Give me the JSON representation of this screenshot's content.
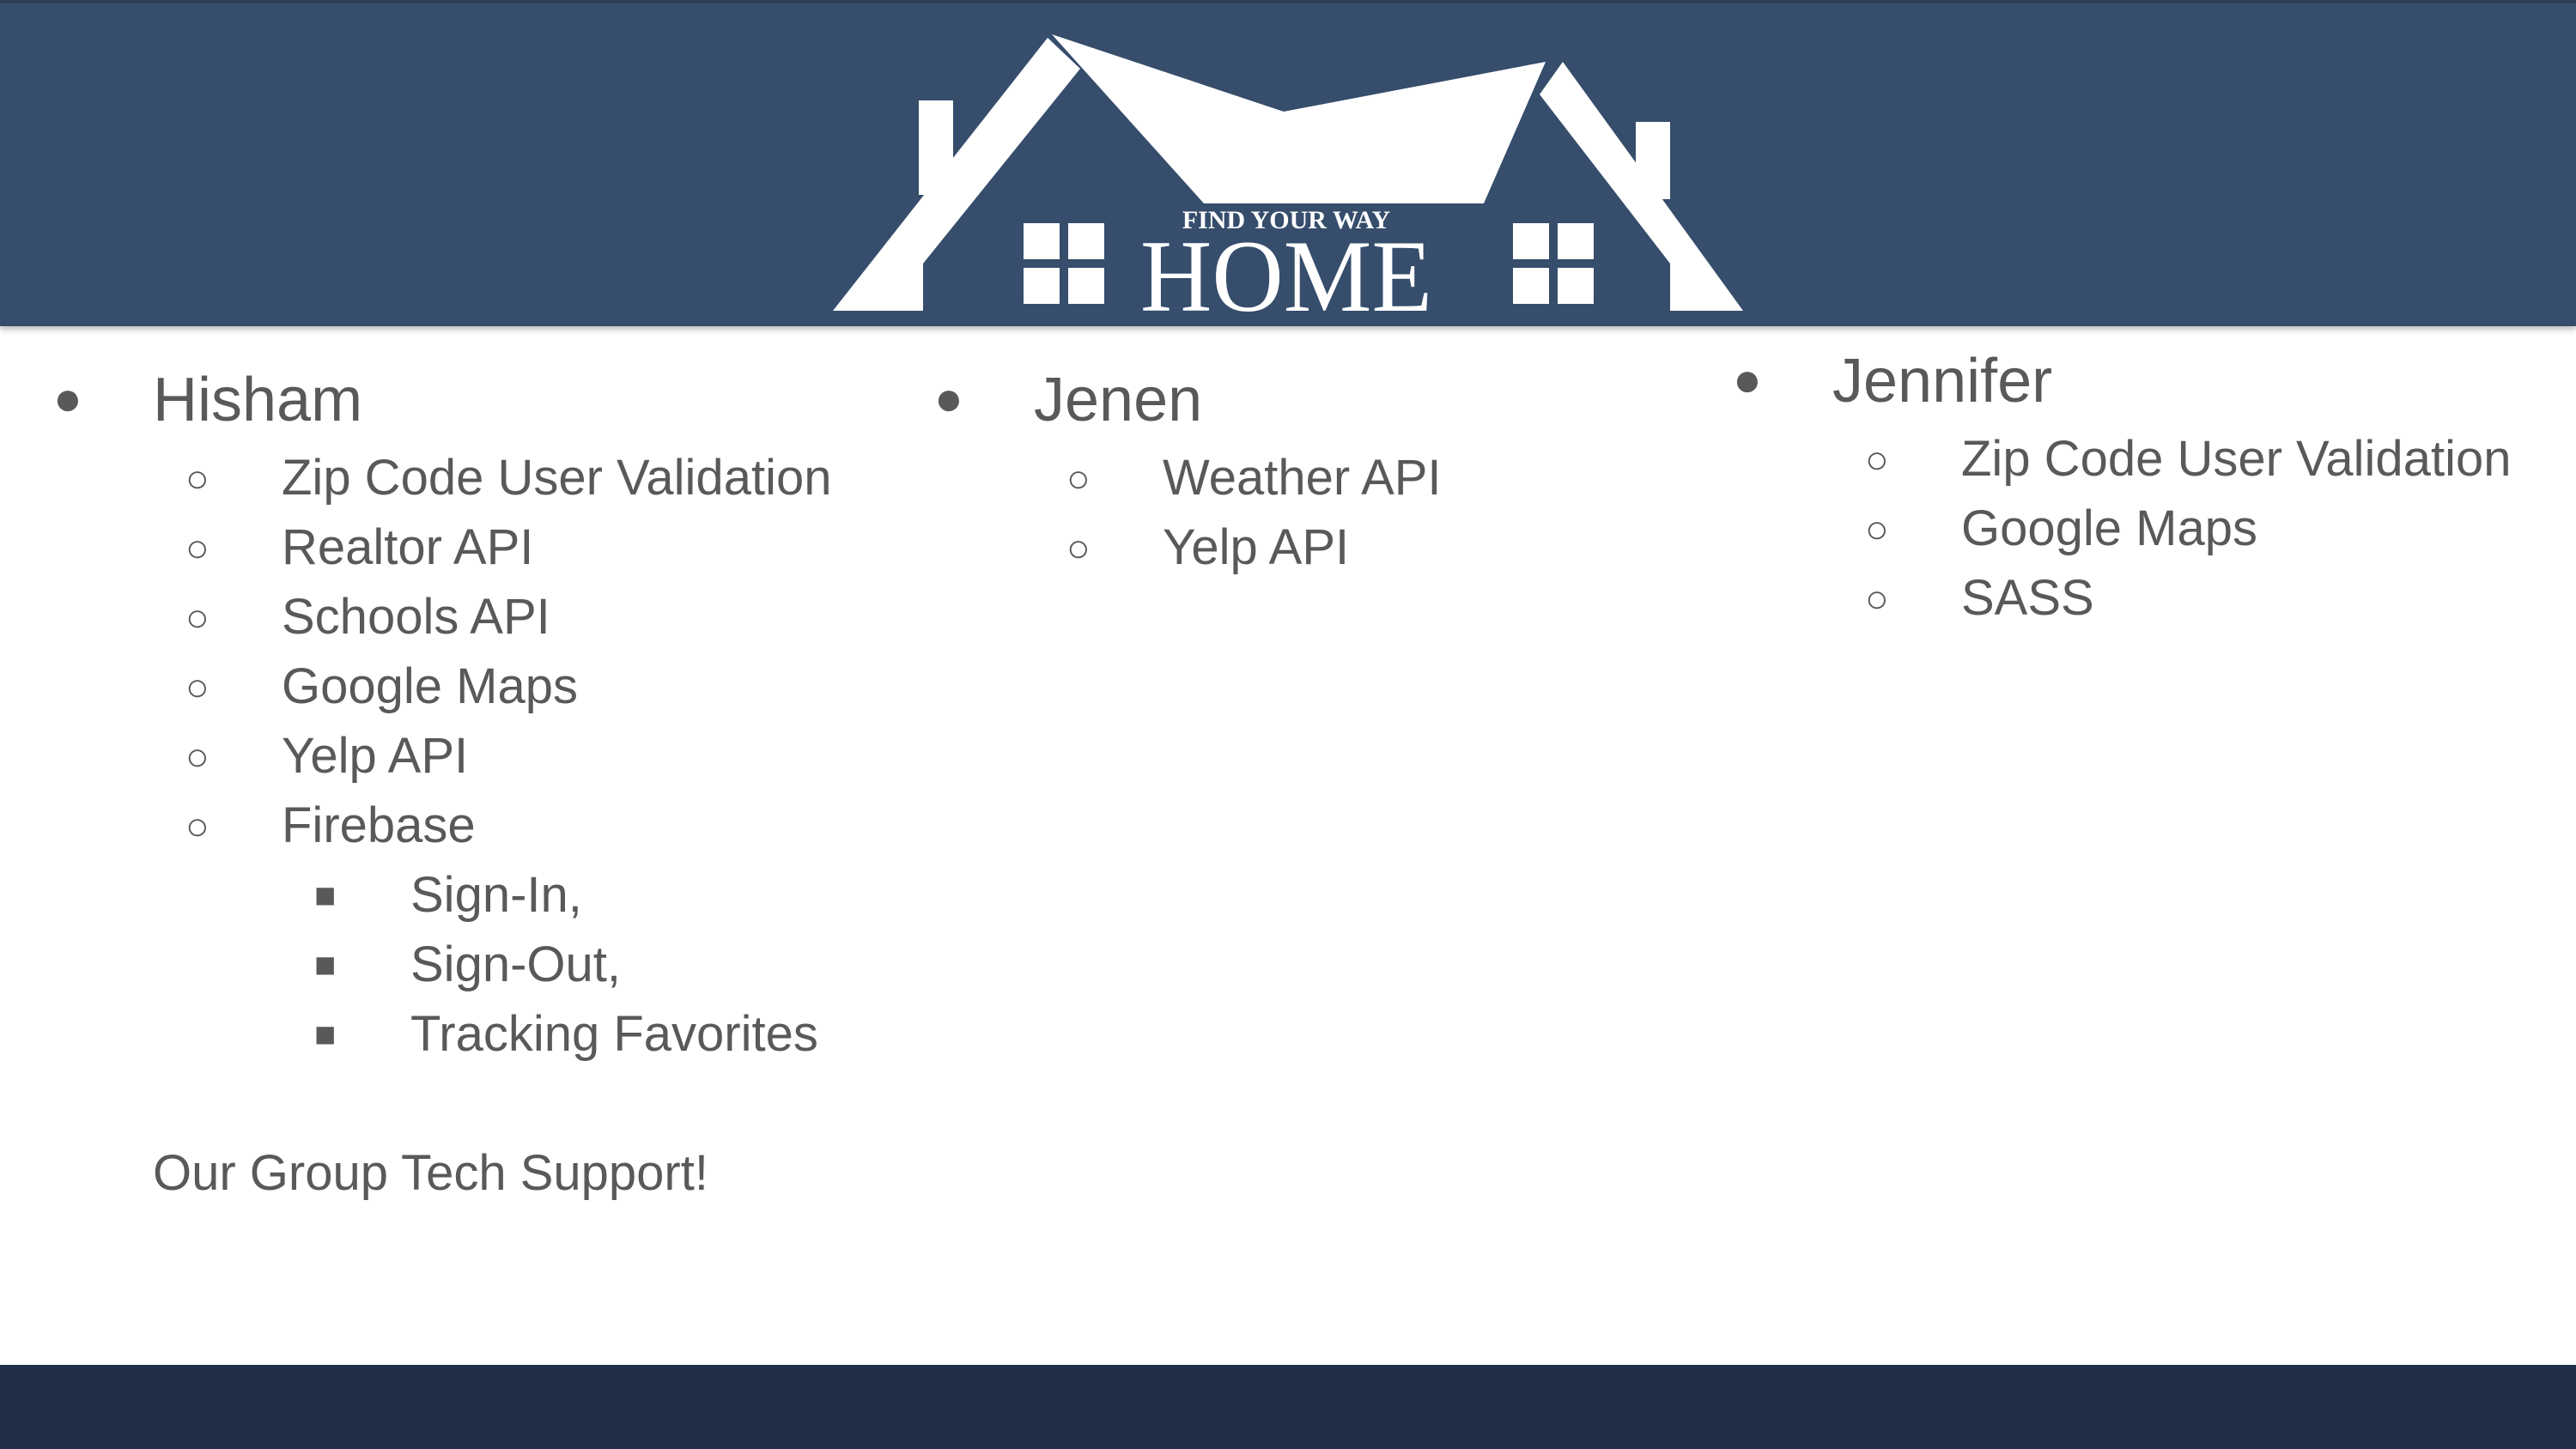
{
  "logo": {
    "tagline": "FIND YOUR WAY",
    "word": "HOME"
  },
  "columns": [
    {
      "name": "Hisham",
      "items": [
        {
          "label": "Zip Code User Validation"
        },
        {
          "label": "Realtor API"
        },
        {
          "label": "Schools API"
        },
        {
          "label": "Google Maps"
        },
        {
          "label": "Yelp API"
        },
        {
          "label": "Firebase",
          "subitems": [
            "Sign-In,",
            "Sign-Out,",
            "Tracking Favorites"
          ]
        }
      ]
    },
    {
      "name": "Jenen",
      "items": [
        {
          "label": "Weather API"
        },
        {
          "label": "Yelp API"
        }
      ]
    },
    {
      "name": "Jennifer",
      "items": [
        {
          "label": "Zip Code User Validation"
        },
        {
          "label": "Google Maps"
        },
        {
          "label": "SASS"
        }
      ]
    }
  ],
  "note": "Our Group Tech Support!",
  "colors": {
    "header": "#364d6c",
    "footer": "#212e48",
    "text": "#595959"
  }
}
